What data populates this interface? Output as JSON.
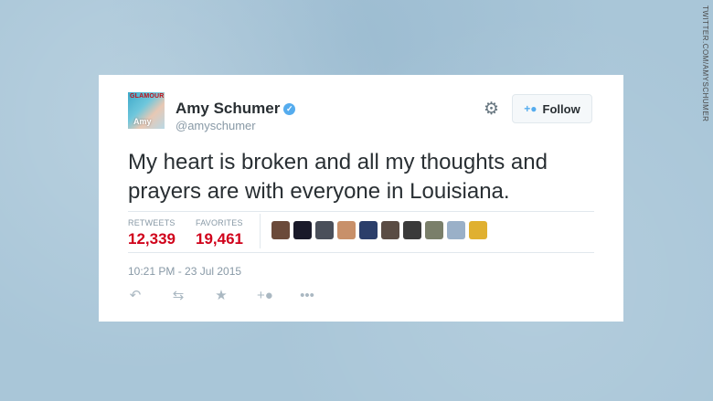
{
  "watermark": "TWITTER.COM/AMYSCHUMER",
  "tweet": {
    "avatar": {
      "magazine": "GLAMOUR",
      "name": "Amy"
    },
    "user_name": "Amy Schumer",
    "verified_icon": "✓",
    "handle": "@amyschumer",
    "follow_label": "Follow",
    "text": "My heart is broken and all my thoughts and prayers are with everyone in Louisiana.",
    "retweets_label": "RETWEETS",
    "retweets_count": "12,339",
    "favorites_label": "FAVORITES",
    "favorites_count": "19,461",
    "timestamp": "10:21 PM - 23 Jul 2015"
  },
  "favoriters": [
    {
      "color": "#6b4a3a"
    },
    {
      "color": "#1a1a2a"
    },
    {
      "color": "#4a4f5a"
    },
    {
      "color": "#c8906a"
    },
    {
      "color": "#2b3e6a"
    },
    {
      "color": "#5a4c44"
    },
    {
      "color": "#3a3a3a"
    },
    {
      "color": "#7a7f6a"
    },
    {
      "color": "#9ab0c8"
    },
    {
      "color": "#e0b030"
    }
  ],
  "icons": {
    "gear": "gear-icon",
    "follow": "add-user-icon",
    "reply": "reply-icon",
    "retweet": "retweet-icon",
    "favorite": "star-icon",
    "follow_action": "add-user-icon",
    "more": "more-icon"
  },
  "colors": {
    "background": "#a9c6d8",
    "count_red": "#d0021b",
    "twitter_blue": "#55acee"
  }
}
